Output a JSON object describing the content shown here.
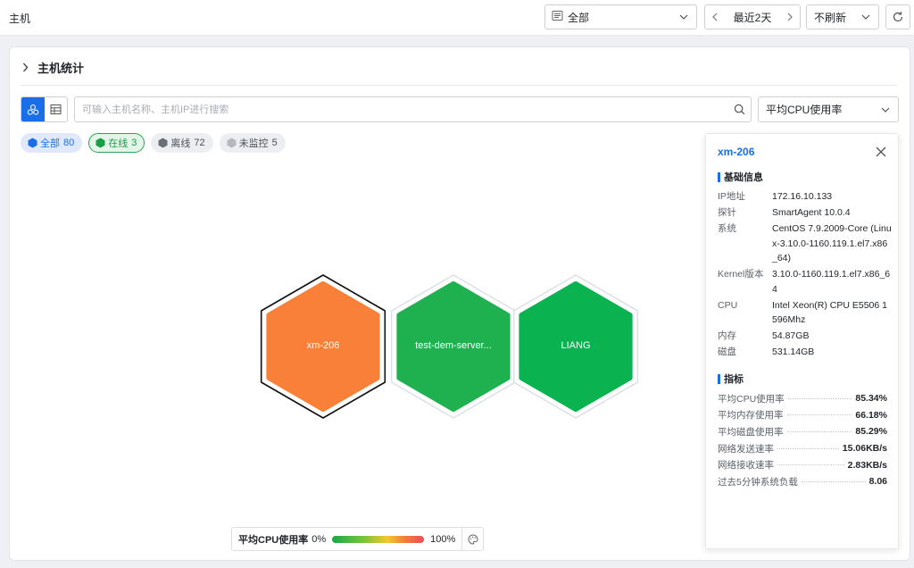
{
  "topbar": {
    "title": "主机",
    "scope": {
      "icon": "list-icon",
      "value": "全部"
    },
    "time": {
      "value": "最近2天"
    },
    "refresh": {
      "value": "不刷新"
    }
  },
  "section": {
    "title": "主机统计"
  },
  "search": {
    "placeholder": "可输入主机名称、主机IP进行搜索",
    "value": ""
  },
  "metric_select": {
    "value": "平均CPU使用率"
  },
  "filters": [
    {
      "label": "全部",
      "count": "80",
      "color": "#1a6fe8"
    },
    {
      "label": "在线",
      "count": "3",
      "color": "#1d9c48"
    },
    {
      "label": "离线",
      "count": "72",
      "color": "#6b7078"
    },
    {
      "label": "未监控",
      "count": "5",
      "color": "#b4b8be"
    }
  ],
  "hosts": [
    {
      "name": "xm-206",
      "color": "#f98039",
      "selected": true
    },
    {
      "name": "test-dem-server...",
      "color": "#1fb14f",
      "selected": false
    },
    {
      "name": "LIANG",
      "color": "#0ab250",
      "selected": false
    }
  ],
  "legend": {
    "title": "平均CPU使用率",
    "min": "0%",
    "max": "100%"
  },
  "detail": {
    "name": "xm-206",
    "basic_title": "基础信息",
    "info": [
      {
        "key": "IP地址",
        "value": "172.16.10.133"
      },
      {
        "key": "探针",
        "value": "SmartAgent 10.0.4"
      },
      {
        "key": "系统",
        "value": "CentOS 7.9.2009-Core (Linux-3.10.0-1160.119.1.el7.x86_64)"
      },
      {
        "key": "Kernel版本",
        "value": "3.10.0-1160.119.1.el7.x86_64"
      },
      {
        "key": "CPU",
        "value": "Intel Xeon(R) CPU E5506 1596Mhz"
      },
      {
        "key": "内存",
        "value": "54.87GB"
      },
      {
        "key": "磁盘",
        "value": "531.14GB"
      }
    ],
    "metrics_title": "指标",
    "metrics": [
      {
        "key": "平均CPU使用率",
        "value": "85.34%"
      },
      {
        "key": "平均内存使用率",
        "value": "66.18%"
      },
      {
        "key": "平均磁盘使用率",
        "value": "85.29%"
      },
      {
        "key": "网络发送速率",
        "value": "15.06KB/s"
      },
      {
        "key": "网络接收速率",
        "value": "2.83KB/s"
      },
      {
        "key": "过去5分钟系统负载",
        "value": "8.06"
      }
    ]
  }
}
